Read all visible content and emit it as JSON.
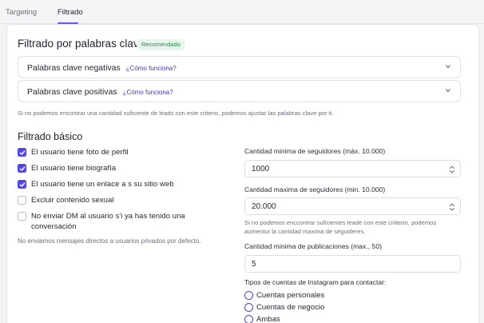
{
  "tabs": [
    {
      "label": "Targeting"
    },
    {
      "label": "Filtrado"
    }
  ],
  "keyword_filter": {
    "title": "Filtrado por palabras clave",
    "badge": "Recomendado",
    "negative": {
      "label": "Palabras clave negativas",
      "link": "¿Cómo funciona?"
    },
    "positive": {
      "label": "Palabras clave positivas",
      "link": "¿Cómo funciona?"
    },
    "hint": "Si no podemos encontrar una cantidad suficiente de leads con este criterio, podemos ajustar las palabras clave por ti."
  },
  "basic_filter": {
    "title": "Filtrado básico",
    "checks": [
      {
        "label": "El usuario tiene foto de perfil",
        "checked": true
      },
      {
        "label": "El usuario tiene biografía",
        "checked": true
      },
      {
        "label": "El usuario tiene un enlace a s su sitio web",
        "checked": true
      },
      {
        "label": "Excluir contenido sexual",
        "checked": false
      },
      {
        "label_line1": "No enviar DM al usuario s'i ya has tenido una",
        "label_line2": "conversación",
        "checked": false
      }
    ],
    "private_note": "No enviamos mensajes directos a usuarios privados por defecto.",
    "min_followers": {
      "label": "Cantidad minima de seguidores (màx. 10.000)",
      "value": "1000"
    },
    "max_followers": {
      "label": "Cantidad maxima de seguidores (min. 10.000)",
      "value": "20.000"
    },
    "followers_hint_line1": "Si no podemos enccontrar suficientes leade con este criiterio, podemos",
    "followers_hint_line2": "aumentur la cantidad maxima de seguideres.",
    "min_posts": {
      "label": "Cantidad minima de publicaciones (max., 50)",
      "value": "5"
    },
    "account_types": {
      "label": "Tipos de cuentas de Instagram para contactar:",
      "options": [
        "Cuentas personales",
        "Cuentas de negocio",
        "Ambas"
      ]
    }
  },
  "colors": {
    "accent": "#4f46e5",
    "badge_bg": "#e7f6ec",
    "badge_text": "#2a8a4d"
  }
}
